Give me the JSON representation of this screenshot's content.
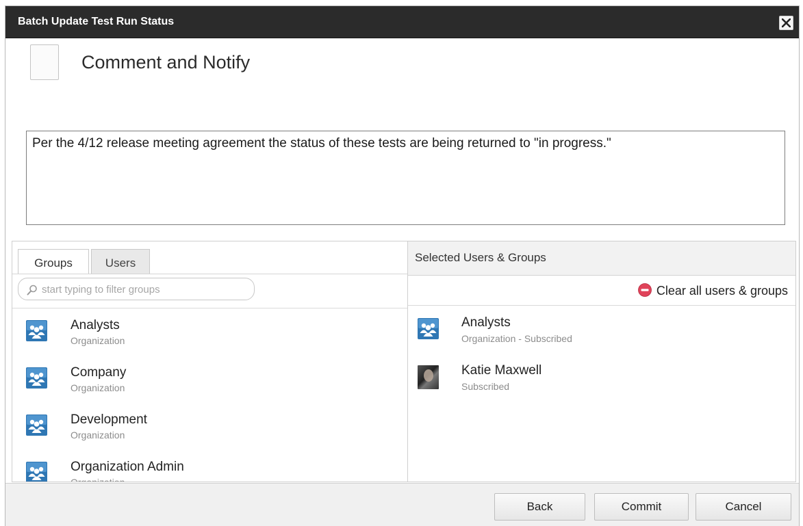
{
  "dialog": {
    "title": "Batch Update Test Run Status",
    "close_icon": "close-x-icon",
    "colors": {
      "titlebar": "#2b2b2b",
      "clear_icon": "#e0435a",
      "group_icon": "#2f77b4"
    }
  },
  "notify": {
    "heading": "Comment and Notify",
    "checked": false
  },
  "comment": {
    "value": "Per the 4/12 release meeting agreement the status of these tests are being returned to \"in progress.\""
  },
  "left": {
    "tabs": [
      {
        "label": "Groups",
        "active": true
      },
      {
        "label": "Users",
        "active": false
      }
    ],
    "filter": {
      "placeholder": "start typing to filter groups",
      "icon": "search-icon"
    },
    "items": [
      {
        "name": "Analysts",
        "type": "Organization",
        "icon": "group-icon"
      },
      {
        "name": "Company",
        "type": "Organization",
        "icon": "group-icon"
      },
      {
        "name": "Development",
        "type": "Organization",
        "icon": "group-icon"
      },
      {
        "name": "Organization Admin",
        "type": "Organization",
        "icon": "group-icon"
      }
    ]
  },
  "right": {
    "heading": "Selected Users & Groups",
    "clear_label": "Clear all users & groups",
    "clear_icon": "minus-circle-icon",
    "items": [
      {
        "name": "Analysts",
        "sub": "Organization - Subscribed",
        "icon": "group-icon"
      },
      {
        "name": "Katie Maxwell",
        "sub": "Subscribed",
        "icon": "user-avatar"
      }
    ]
  },
  "footer": {
    "back_label": "Back",
    "commit_label": "Commit",
    "cancel_label": "Cancel"
  }
}
